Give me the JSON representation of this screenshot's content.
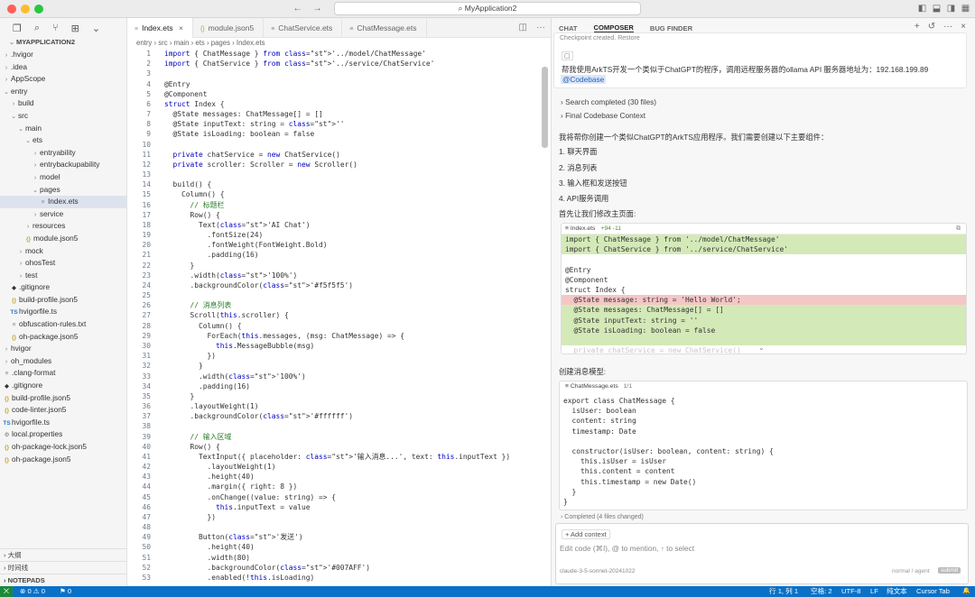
{
  "window": {
    "title": "MyApplication2"
  },
  "sidebar": {
    "title": "MYAPPLICATION2",
    "tree": [
      {
        "label": ".hvigor",
        "indent": 1,
        "type": "folder"
      },
      {
        "label": ".idea",
        "indent": 1,
        "type": "folder"
      },
      {
        "label": "AppScope",
        "indent": 1,
        "type": "folder"
      },
      {
        "label": "entry",
        "indent": 1,
        "type": "folder-open"
      },
      {
        "label": "build",
        "indent": 2,
        "type": "folder"
      },
      {
        "label": "src",
        "indent": 2,
        "type": "folder-open"
      },
      {
        "label": "main",
        "indent": 3,
        "type": "folder-open"
      },
      {
        "label": "ets",
        "indent": 4,
        "type": "folder-open"
      },
      {
        "label": "entryability",
        "indent": 5,
        "type": "folder"
      },
      {
        "label": "entrybackupability",
        "indent": 5,
        "type": "folder"
      },
      {
        "label": "model",
        "indent": 5,
        "type": "folder"
      },
      {
        "label": "pages",
        "indent": 5,
        "type": "folder-open"
      },
      {
        "label": "Index.ets",
        "indent": 6,
        "type": "file",
        "selected": true
      },
      {
        "label": "service",
        "indent": 5,
        "type": "folder"
      },
      {
        "label": "resources",
        "indent": 4,
        "type": "folder"
      },
      {
        "label": "module.json5",
        "indent": 4,
        "type": "json"
      },
      {
        "label": "mock",
        "indent": 3,
        "type": "folder"
      },
      {
        "label": "ohosTest",
        "indent": 3,
        "type": "folder"
      },
      {
        "label": "test",
        "indent": 3,
        "type": "folder"
      },
      {
        "label": ".gitignore",
        "indent": 2,
        "type": "git"
      },
      {
        "label": "build-profile.json5",
        "indent": 2,
        "type": "json"
      },
      {
        "label": "hvigorfile.ts",
        "indent": 2,
        "type": "ts"
      },
      {
        "label": "obfuscation-rules.txt",
        "indent": 2,
        "type": "txt"
      },
      {
        "label": "oh-package.json5",
        "indent": 2,
        "type": "json"
      },
      {
        "label": "hvigor",
        "indent": 1,
        "type": "folder"
      },
      {
        "label": "oh_modules",
        "indent": 1,
        "type": "folder"
      },
      {
        "label": ".clang-format",
        "indent": 1,
        "type": "txt"
      },
      {
        "label": ".gitignore",
        "indent": 1,
        "type": "git"
      },
      {
        "label": "build-profile.json5",
        "indent": 1,
        "type": "json"
      },
      {
        "label": "code-linter.json5",
        "indent": 1,
        "type": "json"
      },
      {
        "label": "hvigorfile.ts",
        "indent": 1,
        "type": "ts"
      },
      {
        "label": "local.properties",
        "indent": 1,
        "type": "gear"
      },
      {
        "label": "oh-package-lock.json5",
        "indent": 1,
        "type": "json"
      },
      {
        "label": "oh-package.json5",
        "indent": 1,
        "type": "json"
      }
    ],
    "bottom": [
      "大纲",
      "时间线",
      "NOTEPADS"
    ]
  },
  "editor": {
    "tabs": [
      "Index.ets",
      "module.json5",
      "ChatService.ets",
      "ChatMessage.ets"
    ],
    "breadcrumb": "entry  ›  src  ›  main  ›  ets  ›  pages  ›  Index.ets",
    "code": [
      "import { ChatMessage } from '../model/ChatMessage'",
      "import { ChatService } from '../service/ChatService'",
      "",
      "@Entry",
      "@Component",
      "struct Index {",
      "  @State messages: ChatMessage[] = []",
      "  @State inputText: string = ''",
      "  @State isLoading: boolean = false",
      "",
      "  private chatService = new ChatService()",
      "  private scroller: Scroller = new Scroller()",
      "",
      "  build() {",
      "    Column() {",
      "      // 标题栏",
      "      Row() {",
      "        Text('AI Chat')",
      "          .fontSize(24)",
      "          .fontWeight(FontWeight.Bold)",
      "          .padding(16)",
      "      }",
      "      .width('100%')",
      "      .backgroundColor('#f5f5f5')",
      "",
      "      // 消息列表",
      "      Scroll(this.scroller) {",
      "        Column() {",
      "          ForEach(this.messages, (msg: ChatMessage) => {",
      "            this.MessageBubble(msg)",
      "          })",
      "        }",
      "        .width('100%')",
      "        .padding(16)",
      "      }",
      "      .layoutWeight(1)",
      "      .backgroundColor('#ffffff')",
      "",
      "      // 输入区域",
      "      Row() {",
      "        TextInput({ placeholder: '输入消息...', text: this.inputText })",
      "          .layoutWeight(1)",
      "          .height(40)",
      "          .margin({ right: 8 })",
      "          .onChange((value: string) => {",
      "            this.inputText = value",
      "          })",
      "",
      "        Button('发送')",
      "          .height(40)",
      "          .width(80)",
      "          .backgroundColor('#007AFF')",
      "          .enabled(!this.isLoading)"
    ]
  },
  "chat": {
    "tabs": [
      "CHAT",
      "COMPOSER",
      "BUG FINDER"
    ],
    "checkpoint": "Checkpoint created.  Restore",
    "prompt": "帮我使用ArkTS开发一个类似于ChatGPT的程序，调用远程服务器的ollama API 服务器地址为：192.168.199.89",
    "mention": "@Codebase",
    "search_completed": "Search completed (30 files)",
    "final_context": "Final Codebase Context",
    "intro": "我将帮你创建一个类似ChatGPT的ArkTS应用程序。我们需要创建以下主要组件：",
    "steps": [
      "1. 聊天界面",
      "2. 消息列表",
      "3. 输入框和发送按钮",
      "4. API服务调用"
    ],
    "first_modify": "首先让我们修改主页面:",
    "diff1": {
      "file": "Index.ets",
      "stats": "+94 -11",
      "lines": [
        {
          "t": "import { ChatMessage } from '../model/ChatMessage'",
          "k": "add"
        },
        {
          "t": "import { ChatService } from '../service/ChatService'",
          "k": "add"
        },
        {
          "t": "",
          "k": ""
        },
        {
          "t": "@Entry",
          "k": ""
        },
        {
          "t": "@Component",
          "k": ""
        },
        {
          "t": "struct Index {",
          "k": ""
        },
        {
          "t": "  @State message: string = 'Hello World';",
          "k": "del"
        },
        {
          "t": "  @State messages: ChatMessage[] = []",
          "k": "add"
        },
        {
          "t": "  @State inputText: string = ''",
          "k": "add"
        },
        {
          "t": "  @State isLoading: boolean = false",
          "k": "add"
        },
        {
          "t": "",
          "k": "add"
        },
        {
          "t": "  private chatService = new ChatService()",
          "k": "fade"
        }
      ]
    },
    "create_model": "创建消息模型:",
    "diff2": {
      "file": "ChatMessage.ets",
      "stats": "1/1",
      "lines": [
        "export class ChatMessage {",
        "  isUser: boolean",
        "  content: string",
        "  timestamp: Date",
        "",
        "  constructor(isUser: boolean, content: string) {",
        "    this.isUser = isUser",
        "    this.content = content",
        "    this.timestamp = new Date()",
        "  }",
        "}"
      ]
    },
    "completed": "Completed  (4 files changed)",
    "add_context": "+ Add context",
    "input_placeholder": "Edit code (⌘I), @ to mention, ↑ to select",
    "model": "claude-3-5-sonnet-20241022",
    "mode": "normal / agent",
    "submit": "submit"
  },
  "statusbar": {
    "left": [
      "⊗ 0 ⚠ 0",
      "⚑ 0"
    ],
    "right": [
      "行 1, 列 1",
      "空格: 2",
      "UTF-8",
      "LF",
      "纯文本",
      "Cursor Tab",
      "🔔"
    ]
  }
}
